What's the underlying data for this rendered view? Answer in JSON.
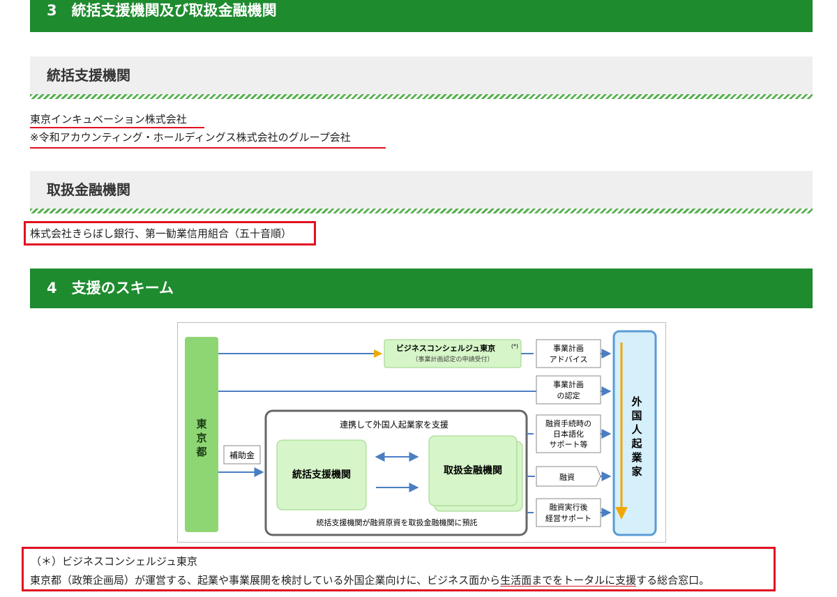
{
  "section3": {
    "title": "3　統括支援機関及び取扱金融機関"
  },
  "support_org": {
    "heading": "統括支援機関",
    "name": "東京インキュベーション株式会社",
    "note": "※令和アカウンティング・ホールディングス株式会社のグループ会社"
  },
  "financial_orgs": {
    "heading": "取扱金融機関",
    "names": "株式会社きらぼし銀行、第一勧業信用組合（五十音順）"
  },
  "section4": {
    "title": "4　支援のスキーム"
  },
  "diagram": {
    "tokyo": [
      "東",
      "京",
      "都"
    ],
    "concierge": "ビジネスコンシェルジュ東京",
    "concierge_mark": "(*)",
    "concierge_sub": "（事業計画認定の申請受付）",
    "cooperation_caption": "連携して外国人起業家を支援",
    "support_org": "統括支援機関",
    "financial_org": "取扱金融機関",
    "subsidy": "補助金",
    "deposit_caption": "統括支援機関が融資原資を取扱金融機関に預託",
    "labels": [
      [
        "事業計画",
        "アドバイス"
      ],
      [
        "事業計画",
        "の認定"
      ],
      [
        "融資手続時の",
        "日本語化",
        "サポート等"
      ],
      [
        "融資"
      ],
      [
        "融資実行後",
        "経営サポート"
      ]
    ],
    "entrepreneur": [
      "外",
      "国",
      "人",
      "起",
      "業",
      "家"
    ]
  },
  "note": {
    "line1": "（＊）ビジネスコンシェルジュ東京",
    "line2_a": "東京都（政策企画局）が運営する、起業や事業展開を検討している外国企業向けに、ビジネス面から",
    "line2_b": "生活面までをトータルに支援",
    "line2_c": "する総合窓口。"
  },
  "colors": {
    "header_green": "#1e8b2f",
    "accent_red": "#e01020",
    "box_green": "#d6f5c8",
    "tokyo_green": "#8ed673",
    "arrow_blue": "#4a7ec2"
  }
}
